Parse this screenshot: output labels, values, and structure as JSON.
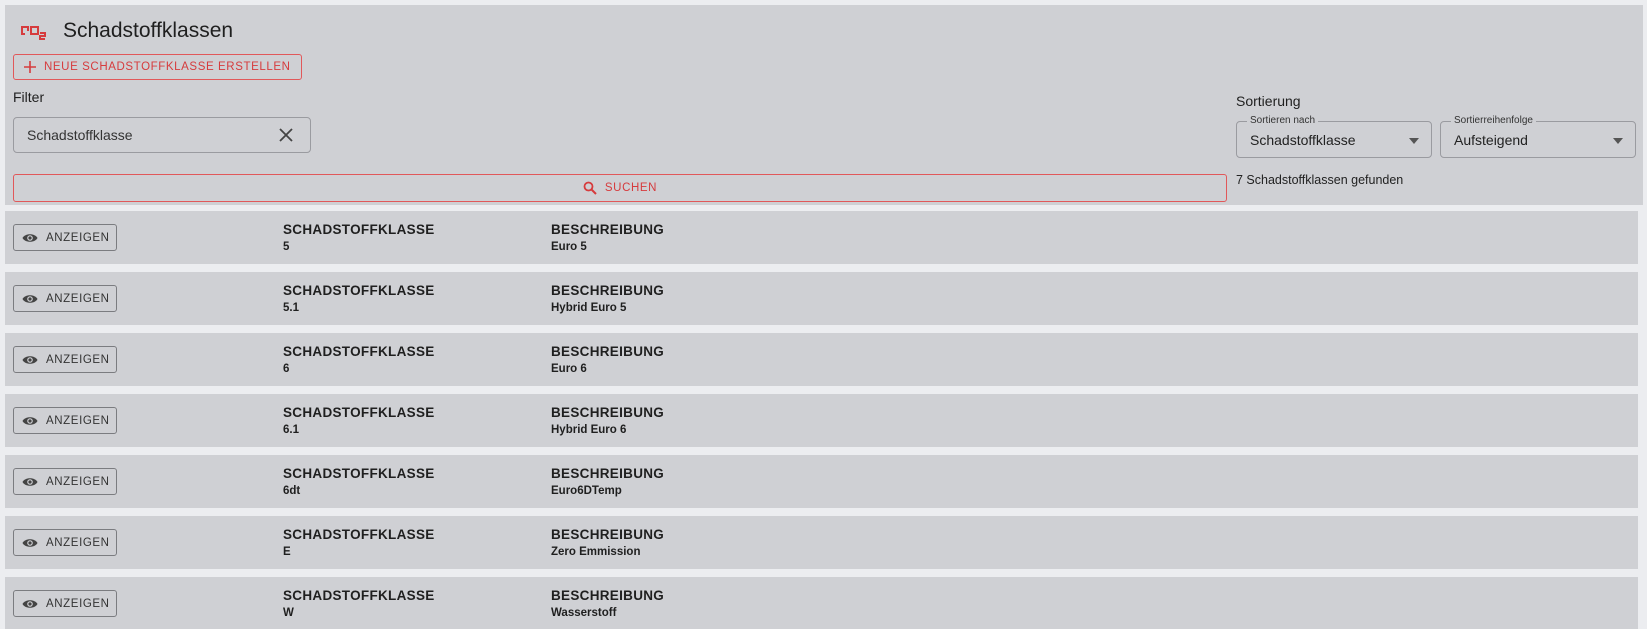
{
  "header": {
    "title": "Schadstoffklassen",
    "icon": "co2-icon",
    "accent_color": "#d63b3d"
  },
  "actions": {
    "create_label": "NEUE SCHADSTOFFKLASSE ERSTELLEN",
    "search_label": "SUCHEN"
  },
  "filter": {
    "heading": "Filter",
    "value": "Schadstoffklasse"
  },
  "sorting": {
    "heading": "Sortierung",
    "sort_by_label": "Sortieren nach",
    "sort_by_value": "Schadstoffklasse",
    "order_label": "Sortierreihenfolge",
    "order_value": "Aufsteigend"
  },
  "results": {
    "count_text": "7 Schadstoffklassen gefunden"
  },
  "list": {
    "show_label": "ANZEIGEN",
    "col1_header": "SCHADSTOFFKLASSE",
    "col2_header": "BESCHREIBUNG",
    "rows": [
      {
        "klasse": "5",
        "beschreibung": "Euro 5"
      },
      {
        "klasse": "5.1",
        "beschreibung": "Hybrid Euro 5"
      },
      {
        "klasse": "6",
        "beschreibung": "Euro 6"
      },
      {
        "klasse": "6.1",
        "beschreibung": "Hybrid Euro 6"
      },
      {
        "klasse": "6dt",
        "beschreibung": "Euro6DTemp"
      },
      {
        "klasse": "E",
        "beschreibung": "Zero Emmission"
      },
      {
        "klasse": "W",
        "beschreibung": "Wasserstoff"
      }
    ]
  }
}
